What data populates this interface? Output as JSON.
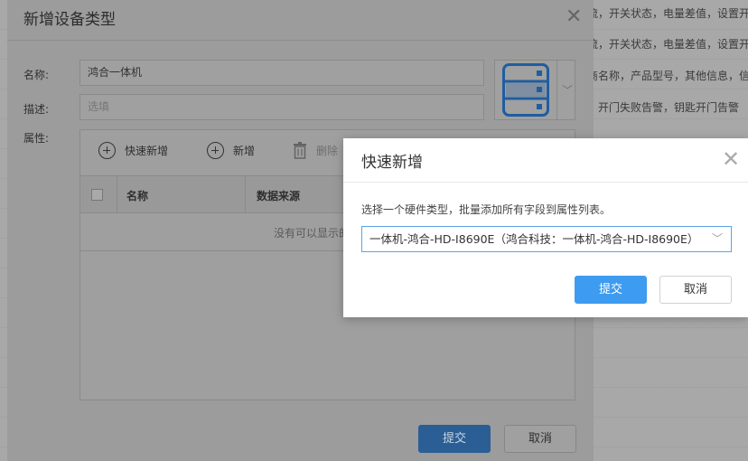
{
  "background": {
    "rows": [
      "流，开关状态，电量差值，设置开",
      "流，开关状态，电量差值，设置开",
      "商名称，产品型号，其他信息，信",
      "，开门失败告警，钥匙开门告警"
    ]
  },
  "main_dialog": {
    "title": "新增设备类型",
    "close": "✕",
    "fields": {
      "name_label": "名称:",
      "name_value": "鸿合一体机",
      "desc_label": "描述:",
      "desc_placeholder": "选填",
      "attr_label": "属性:"
    },
    "icon_name": "server-icon",
    "toolbar": {
      "quick_add": "快速新增",
      "add": "新增",
      "delete": "删除"
    },
    "table": {
      "columns": [
        "名称",
        "数据来源"
      ],
      "empty_text": "没有可以显示的记录。"
    },
    "submit": "提交",
    "cancel": "取消"
  },
  "quick_dialog": {
    "title": "快速新增",
    "close": "✕",
    "description": "选择一个硬件类型，批量添加所有字段到属性列表。",
    "select_value": "一体机-鸿合-HD-I8690E（鸿合科技：一体机-鸿合-HD-I8690E）",
    "submit": "提交",
    "cancel": "取消"
  },
  "colors": {
    "primary": "#3d9bf0",
    "icon_blue": "#2f7fd4",
    "overlay": "#9c9c9c"
  }
}
